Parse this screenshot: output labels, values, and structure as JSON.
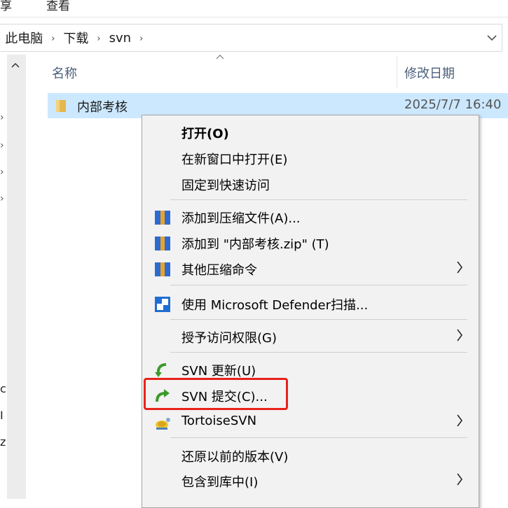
{
  "ribbon": {
    "tab_share": "享",
    "tab_view": "查看"
  },
  "address": {
    "crumbs": [
      "此电脑",
      "下载",
      "svn"
    ],
    "separator": "›"
  },
  "nav": {
    "fragments": [
      "c",
      "I",
      "z"
    ]
  },
  "columns": {
    "name": "名称",
    "modified": "修改日期"
  },
  "file": {
    "name": "内部考核",
    "modified": "2025/7/7 16:40"
  },
  "menu": {
    "open": "打开(O)",
    "open_new_window": "在新窗口中打开(E)",
    "pin_quick_access": "固定到快速访问",
    "add_archive": "添加到压缩文件(A)...",
    "add_zip": "添加到 \"内部考核.zip\" (T)",
    "other_compress": "其他压缩命令",
    "defender_scan": "使用 Microsoft Defender扫描...",
    "grant_access": "授予访问权限(G)",
    "svn_update": "SVN 更新(U)",
    "svn_commit": "SVN 提交(C)...",
    "tortoise": "TortoiseSVN",
    "restore": "还原以前的版本(V)",
    "include_library": "包含到库中(I)"
  },
  "colors": {
    "selection": "#cce8ff",
    "highlight_box": "#e8221b",
    "menu_bg": "#f2f2f2"
  }
}
